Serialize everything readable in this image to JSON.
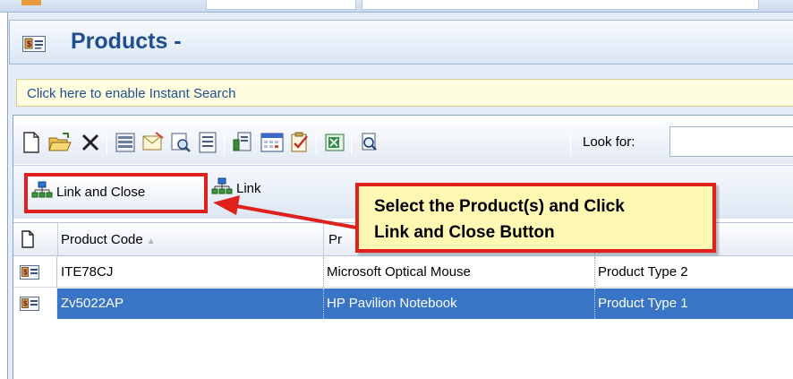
{
  "window": {
    "title": "Products -"
  },
  "search_banner": {
    "text": "Click here to enable Instant Search"
  },
  "toolbar": {
    "icons": [
      "new-icon",
      "open-icon",
      "delete-icon",
      "list-view-icon",
      "email-icon",
      "find-icon",
      "form-view-icon",
      "report-icon",
      "calendar-icon",
      "task-icon",
      "excel-icon",
      "search-doc-icon"
    ],
    "look_for_label": "Look for:",
    "look_for_value": ""
  },
  "actions": {
    "link_and_close_label": "Link and Close",
    "link_label": "Link"
  },
  "grid": {
    "columns": [
      "Product Code",
      "Pr",
      ""
    ],
    "sort_indicator": "▲",
    "rows": [
      {
        "code": "ITE78CJ",
        "name": "Microsoft Optical Mouse",
        "type": "Product Type 2",
        "selected": false
      },
      {
        "code": "Zv5022AP",
        "name": "HP Pavilion Notebook",
        "type": "Product Type 1",
        "selected": true
      }
    ]
  },
  "callout": {
    "line1": "Select the Product(s) and Click",
    "line2": "Link and Close Button"
  },
  "colors": {
    "title": "#1f4f8f",
    "highlight": "#e0201c",
    "selected_row": "#3875c7",
    "callout_bg": "#fff8b2"
  }
}
